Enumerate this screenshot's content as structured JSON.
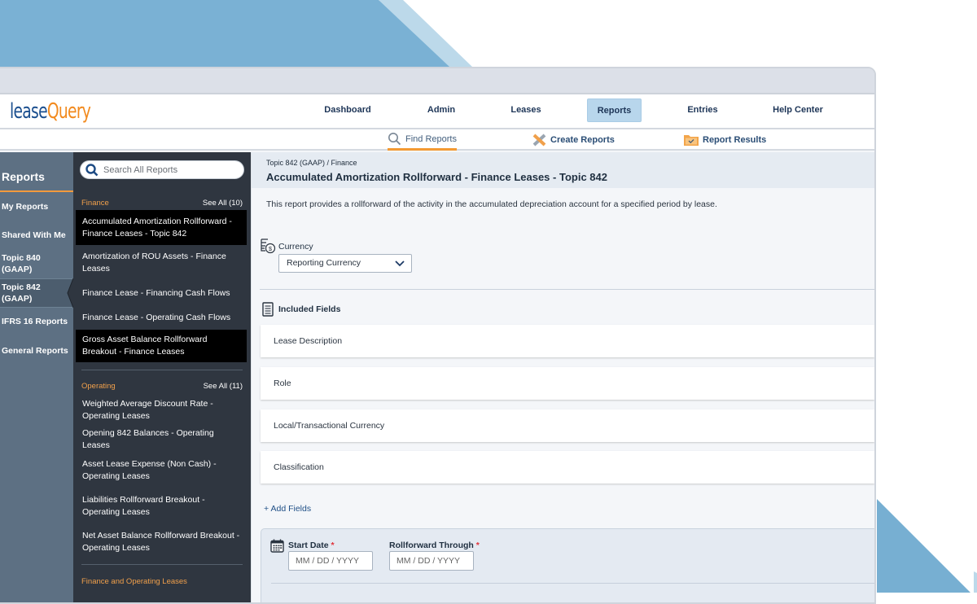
{
  "brand": {
    "logo_part1": "lease",
    "logo_part2": "Query"
  },
  "colors": {
    "brand_blue": "#1b4f8f",
    "brand_orange": "#f28a1e",
    "active_nav_bg": "#b8d6ec",
    "accent_orange": "#f39a33",
    "required_red": "#e0333b"
  },
  "topnav": {
    "items": [
      {
        "label": "Dashboard"
      },
      {
        "label": "Admin"
      },
      {
        "label": "Leases"
      },
      {
        "label": "Reports",
        "active": true
      },
      {
        "label": "Entries"
      },
      {
        "label": "Help Center"
      }
    ]
  },
  "subnav": {
    "items": [
      {
        "label": "Find Reports",
        "icon": "search-icon",
        "active": true
      },
      {
        "label": "Create Reports",
        "icon": "pencil-ruler-icon"
      },
      {
        "label": "Report Results",
        "icon": "folder-check-icon"
      }
    ]
  },
  "leftnav": {
    "title": "Reports",
    "items": [
      {
        "label": "My Reports"
      },
      {
        "label": "Shared With Me"
      },
      {
        "label": "Topic 840 (GAAP)"
      },
      {
        "label": "Topic 842 (GAAP)",
        "active": true
      },
      {
        "label": "IFRS 16 Reports"
      },
      {
        "label": "General Reports"
      }
    ]
  },
  "reportlist": {
    "search_placeholder": "Search All Reports",
    "sections": [
      {
        "name": "Finance",
        "see_all": "See All (10)",
        "items": [
          {
            "label": "Accumulated Amortization Rollforward - Finance Leases - Topic 842",
            "highlighted": true
          },
          {
            "label": "Amortization of ROU Assets - Finance Leases"
          },
          {
            "label": "Finance Lease - Financing Cash Flows"
          },
          {
            "label": "Finance Lease - Operating Cash Flows"
          },
          {
            "label": "Gross Asset Balance Rollforward Breakout - Finance Leases",
            "highlighted": true
          }
        ]
      },
      {
        "name": "Operating",
        "see_all": "See All (11)",
        "items": [
          {
            "label": "Weighted Average Discount Rate - Operating Leases"
          },
          {
            "label": "Opening 842 Balances - Operating Leases"
          },
          {
            "label": "Asset Lease Expense (Non Cash) - Operating Leases"
          },
          {
            "label": "Liabilities Rollforward Breakout - Operating Leases"
          },
          {
            "label": "Net Asset Balance Rollforward Breakout - Operating Leases"
          }
        ]
      },
      {
        "name": "Finance and Operating Leases"
      }
    ]
  },
  "main": {
    "breadcrumb": "Topic 842 (GAAP) / Finance",
    "title": "Accumulated Amortization Rollforward - Finance Leases - Topic 842",
    "description": "This report provides a rollforward of the activity in the accumulated depreciation account for a specified period by lease.",
    "currency": {
      "label": "Currency",
      "selected": "Reporting Currency"
    },
    "included_fields": {
      "label": "Included Fields",
      "fields": [
        "Lease Description",
        "Role",
        "Local/Transactional Currency",
        "Classification"
      ],
      "add_label": "+ Add Fields"
    },
    "dates": {
      "start": {
        "label": "Start Date",
        "required_mark": "*",
        "placeholder": "MM / DD / YYYY"
      },
      "through": {
        "label": "Rollforward Through",
        "required_mark": "*",
        "placeholder": "MM / DD / YYYY"
      }
    }
  }
}
